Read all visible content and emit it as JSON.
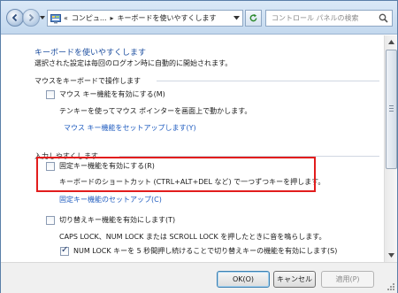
{
  "address": {
    "chevron": "«",
    "crumb1": "コンピュ...",
    "separator": "▸",
    "crumb2": "キーボードを使いやすくします"
  },
  "search": {
    "placeholder": "コントロール パネルの検索"
  },
  "page": {
    "title": "キーボードを使いやすくします",
    "description": "選択された設定は毎回のログオン時に自動的に開始されます。"
  },
  "groups": {
    "mouse": {
      "header": "マウスをキーボードで操作します",
      "checkbox_label": "マウス キー機能を有効にする(M)",
      "description": "テンキーを使ってマウス ポインターを画面上で動かします。",
      "link": "マウス キー機能をセットアップします(Y)"
    },
    "typing": {
      "header": "入力しやすくします",
      "sticky_label": "固定キー機能を有効にする(R)",
      "sticky_desc": "キーボードのショートカット (CTRL+ALT+DEL など) で一つずつキーを押します。",
      "sticky_link": "固定キー機能のセットアップ(C)",
      "toggle_label": "切り替えキー機能を有効にします(T)",
      "toggle_desc": "CAPS LOCK、NUM LOCK または SCROLL LOCK を押したときに音を鳴らします。",
      "numlock_label": "NUM LOCK キーを 5 秒間押し続けることで切り替えキーの機能を有効にします(S)"
    }
  },
  "buttons": {
    "ok": "OK(O)",
    "cancel": "キャンセル",
    "apply": "適用(P)"
  },
  "colors": {
    "link": "#1e5bbf",
    "title": "#1e4fa0",
    "highlight": "#e21d1d"
  }
}
